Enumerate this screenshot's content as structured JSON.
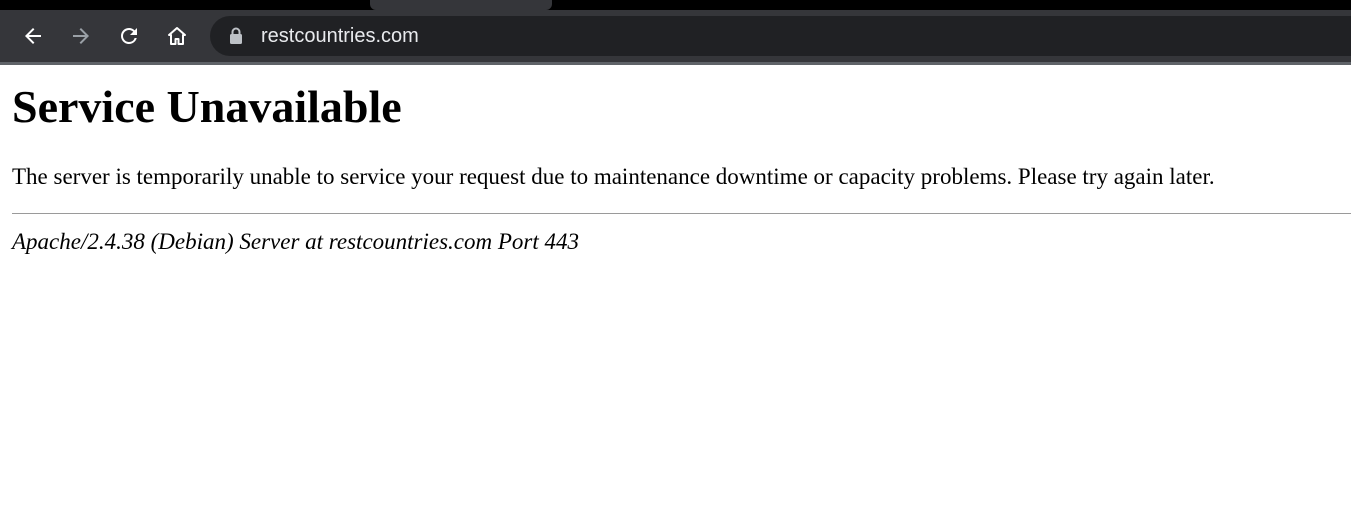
{
  "browser": {
    "url": "restcountries.com",
    "icons": {
      "back": "arrow-left-icon",
      "forward": "arrow-right-icon",
      "reload": "reload-icon",
      "home": "home-icon",
      "security": "lock-icon"
    },
    "colors": {
      "frame": "#000000",
      "toolbar": "#35363a",
      "omnibox": "#202124",
      "url_text": "#e8eaed",
      "forward_disabled": "#9aa0a6"
    }
  },
  "page": {
    "title": "Service Unavailable",
    "message": "The server is temporarily unable to service your request due to maintenance downtime or capacity problems. Please try again later.",
    "server_signature": "Apache/2.4.38 (Debian) Server at restcountries.com Port 443"
  }
}
